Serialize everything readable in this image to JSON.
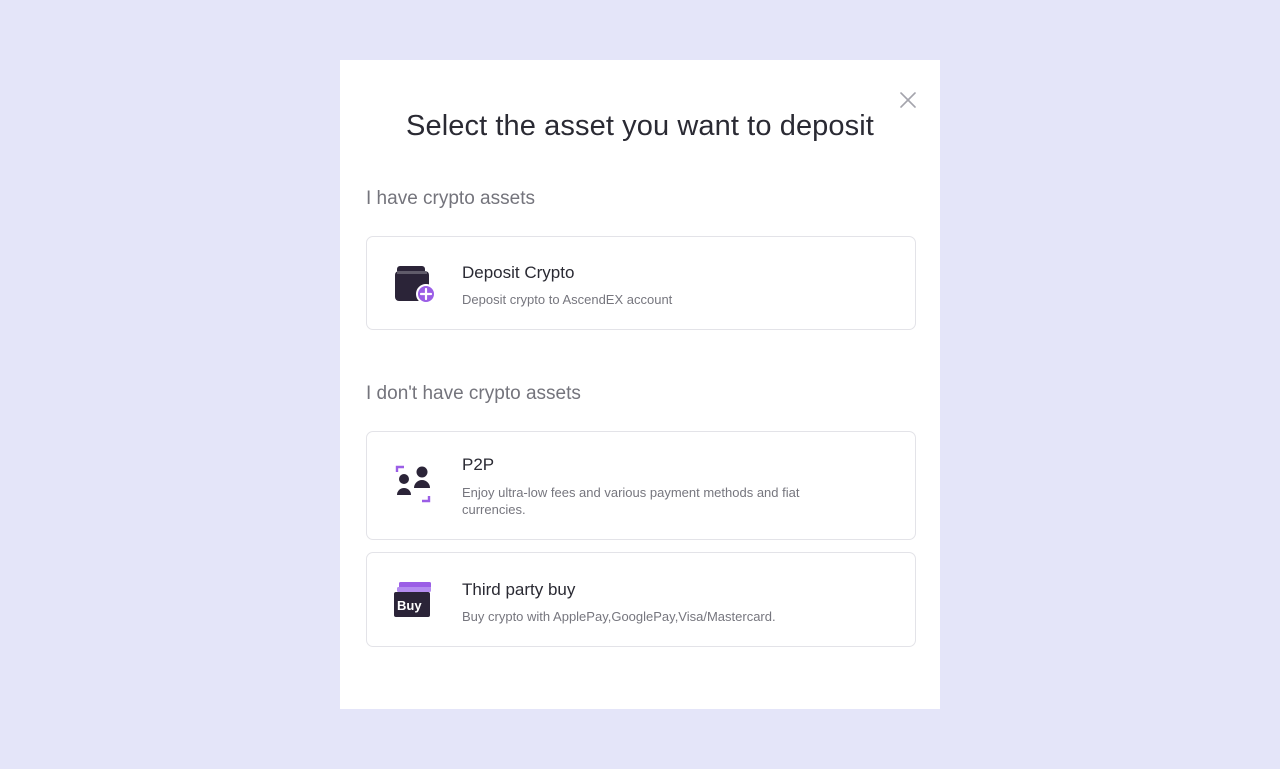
{
  "modal": {
    "title": "Select the asset you want to deposit",
    "close_icon": "close-icon"
  },
  "sections": {
    "have_crypto": {
      "label": "I have crypto assets",
      "options": [
        {
          "icon": "wallet-plus-icon",
          "title": "Deposit Crypto",
          "description": "Deposit crypto to AscendEX account"
        }
      ]
    },
    "no_crypto": {
      "label": "I don't have crypto assets",
      "options": [
        {
          "icon": "p2p-users-icon",
          "title": "P2P",
          "description": "Enjoy ultra-low fees and various payment methods and fiat currencies."
        },
        {
          "icon": "buy-cards-icon",
          "title": "Third party buy",
          "description": "Buy crypto with ApplePay,GooglePay,Visa/Mastercard.",
          "icon_text": "Buy"
        }
      ]
    }
  },
  "colors": {
    "background": "#e4e5f9",
    "icon_dark": "#2b2438",
    "icon_accent": "#9b5ee6"
  }
}
